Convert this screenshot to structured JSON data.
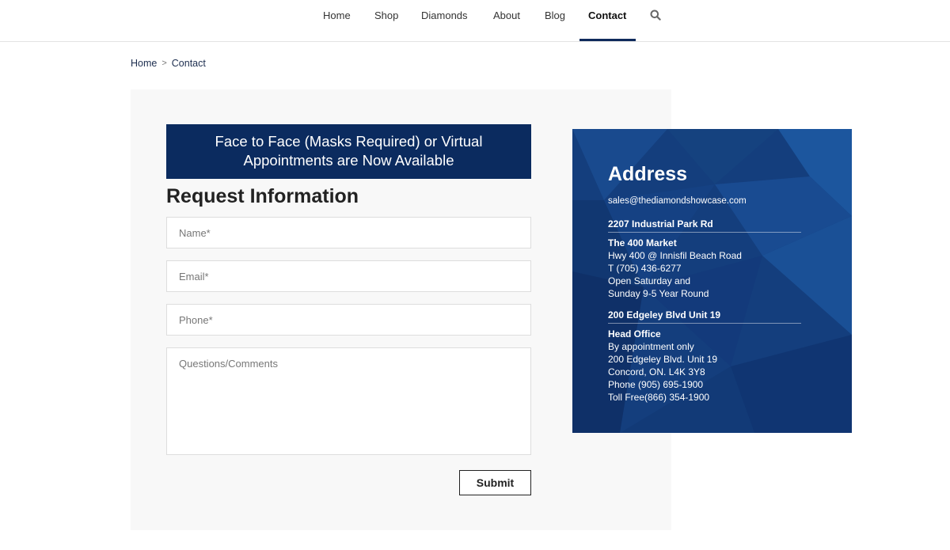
{
  "nav": {
    "items": [
      {
        "label": "Home"
      },
      {
        "label": "Shop"
      },
      {
        "label": "Diamonds"
      },
      {
        "label": "About"
      },
      {
        "label": "Blog"
      },
      {
        "label": "Contact"
      }
    ],
    "active": "Contact",
    "search_icon": "search-icon"
  },
  "breadcrumb": {
    "home": "Home",
    "separator": ">",
    "current": "Contact"
  },
  "banner": {
    "line1": "Face to Face (Masks Required) or Virtual",
    "line2": "Appointments are Now Available"
  },
  "form": {
    "title": "Request Information",
    "name_placeholder": "Name*",
    "email_placeholder": "Email*",
    "phone_placeholder": "Phone*",
    "comments_placeholder": "Questions/Comments",
    "submit_label": "Submit"
  },
  "address": {
    "title": "Address",
    "email": "sales@thediamondshowcase.com",
    "locations": [
      {
        "title": "2207 Industrial Park Rd",
        "name": "The 400 Market",
        "lines": [
          "Hwy 400 @ Innisfil Beach Road",
          "T (705) 436-6277",
          "Open Saturday and",
          "Sunday 9-5 Year Round"
        ]
      },
      {
        "title": "200 Edgeley Blvd Unit 19",
        "name": "Head Office",
        "lines": [
          "By appointment only",
          "200 Edgeley Blvd. Unit 19",
          "Concord, ON. L4K 3Y8",
          "Phone (905) 695-1900",
          "Toll Free(866) 354-1900"
        ]
      }
    ]
  },
  "colors": {
    "banner": "#0b2b5f",
    "card": "#123a78",
    "nav_underline": "#0f2a5c",
    "panel": "#f8f8f8"
  }
}
